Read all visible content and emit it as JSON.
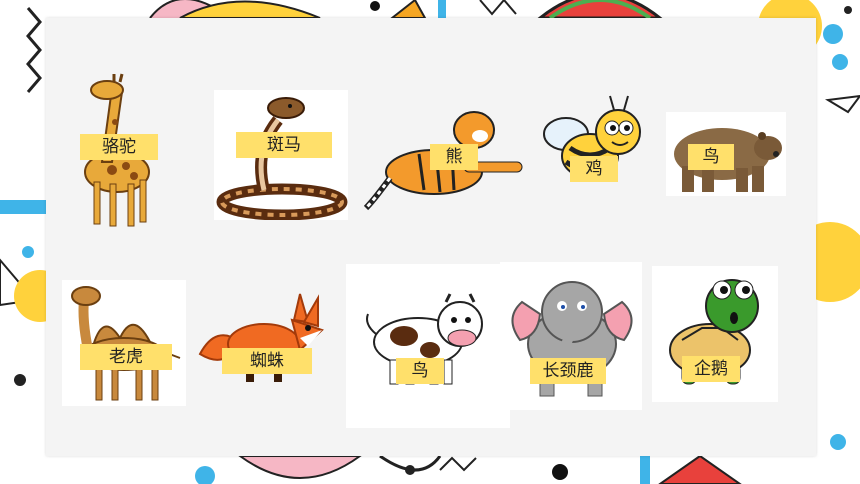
{
  "slide": {
    "cards": [
      {
        "label": "骆驼",
        "image_icon": "giraffe-icon"
      },
      {
        "label": "斑马",
        "image_icon": "snake-icon"
      },
      {
        "label": "熊",
        "image_icon": "tiger-icon"
      },
      {
        "label": "鸡",
        "image_icon": "bee-icon"
      },
      {
        "label": "鸟",
        "image_icon": "bear-icon"
      },
      {
        "label": "老虎",
        "image_icon": "camel-icon"
      },
      {
        "label": "蜘蛛",
        "image_icon": "fox-icon"
      },
      {
        "label": "鸟",
        "image_icon": "cow-icon"
      },
      {
        "label": "长颈鹿",
        "image_icon": "elephant-icon"
      },
      {
        "label": "企鹅",
        "image_icon": "turtle-icon"
      }
    ]
  },
  "colors": {
    "tag": "#ffe06b",
    "accent_yellow": "#ffd23c",
    "accent_blue": "#3fb4e8",
    "accent_pink": "#f4a0b0",
    "accent_red": "#e8413c"
  }
}
